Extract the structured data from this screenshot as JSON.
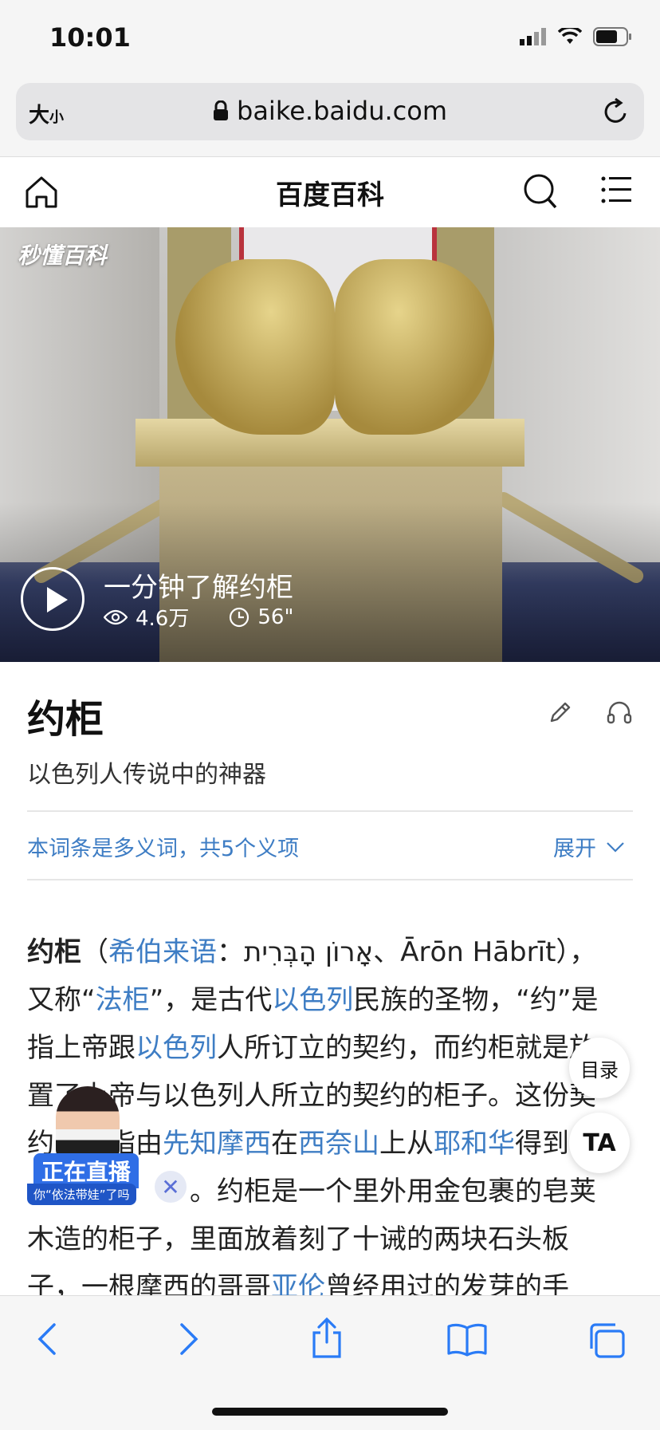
{
  "status_bar": {
    "time": "10:01",
    "icons": [
      "signal-icon",
      "wifi-icon",
      "battery-icon"
    ]
  },
  "browser": {
    "text_size_label": "大",
    "text_size_small": "小",
    "url": "baike.baidu.com"
  },
  "site_header": {
    "title": "百度百科"
  },
  "video": {
    "logo": "秒懂百科",
    "title": "一分钟了解约柜",
    "views": "4.6万",
    "duration": "56\""
  },
  "entry": {
    "title": "约柜",
    "subtitle": "以色列人传说中的神器",
    "polysemy_notice": "本词条是多义词，共5个义项",
    "expand_label": "展开"
  },
  "body": {
    "l1": {
      "t1": "约柜",
      "t2": "（",
      "t3": "希伯来语",
      "t4": "：אָרוֹן הָבְּרִית、Ārōn Hābrīt），"
    },
    "l2": {
      "t1": "又称“",
      "t2": "法柜",
      "t3": "”，是古代",
      "t4": "以色列",
      "t5": "民族的圣物，“约”是"
    },
    "l3": {
      "t1": "指上帝跟",
      "t2": "以色列",
      "t3": "人所订立的契约，而约柜就是放"
    },
    "l4": {
      "t1": "置了上帝与以色列人所立的契约的柜子。这份契"
    },
    "l5": {
      "t1": "约　　指由",
      "t2": "先知摩西",
      "t3": "在",
      "t4": "西奈山",
      "t5": "上从",
      "t6": "耶和华",
      "t7": "得到"
    },
    "l6": {
      "t1": "　　　　　　。约柜是一个里外用金包裹的皂荚"
    },
    "l7": {
      "t1": "木造的柜子，里面放着刻了十诫的两块石头板"
    },
    "l8": {
      "t1": "子，一根摩西的哥哥",
      "t2": "亚伦",
      "t3": "曾经用过的发芽的手"
    }
  },
  "floating": {
    "toc": "目录",
    "ta": "TA"
  },
  "live": {
    "badge": "正在直播",
    "subtitle": "你“依法带娃”了吗",
    "close": "✕"
  },
  "colors": {
    "link": "#3e7dc4",
    "live_blue": "#2f6ee6",
    "ios_blue": "#2a7bf6"
  }
}
